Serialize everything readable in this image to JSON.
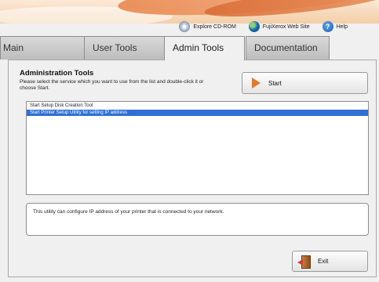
{
  "toolbar": {
    "explore": {
      "label": "Explore CD-ROM",
      "icon": "cd-rom-icon"
    },
    "website": {
      "label": "FujiXerox Web Site",
      "icon": "globe-icon"
    },
    "help": {
      "label": "Help",
      "icon": "help-icon",
      "glyph": "?"
    }
  },
  "tabs": [
    {
      "label": "Main"
    },
    {
      "label": "User Tools"
    },
    {
      "label": "Admin Tools",
      "active": true
    },
    {
      "label": "Documentation"
    }
  ],
  "admin": {
    "title": "Administration Tools",
    "description": "Please select the service which you want to use from the list and double-click it or choose Start.",
    "start_label": "Start",
    "items": [
      {
        "label": "Start Setup Disk Creation Tool",
        "selected": false
      },
      {
        "label": "Start Printer Setup Utility for setting IP address",
        "selected": true
      }
    ],
    "info": "This utility can configure IP address of your printer that is connected to your network.",
    "exit_label": "Exit"
  },
  "colors": {
    "accent_orange": "#e07a2e",
    "selection_blue": "#2f6fd6"
  }
}
